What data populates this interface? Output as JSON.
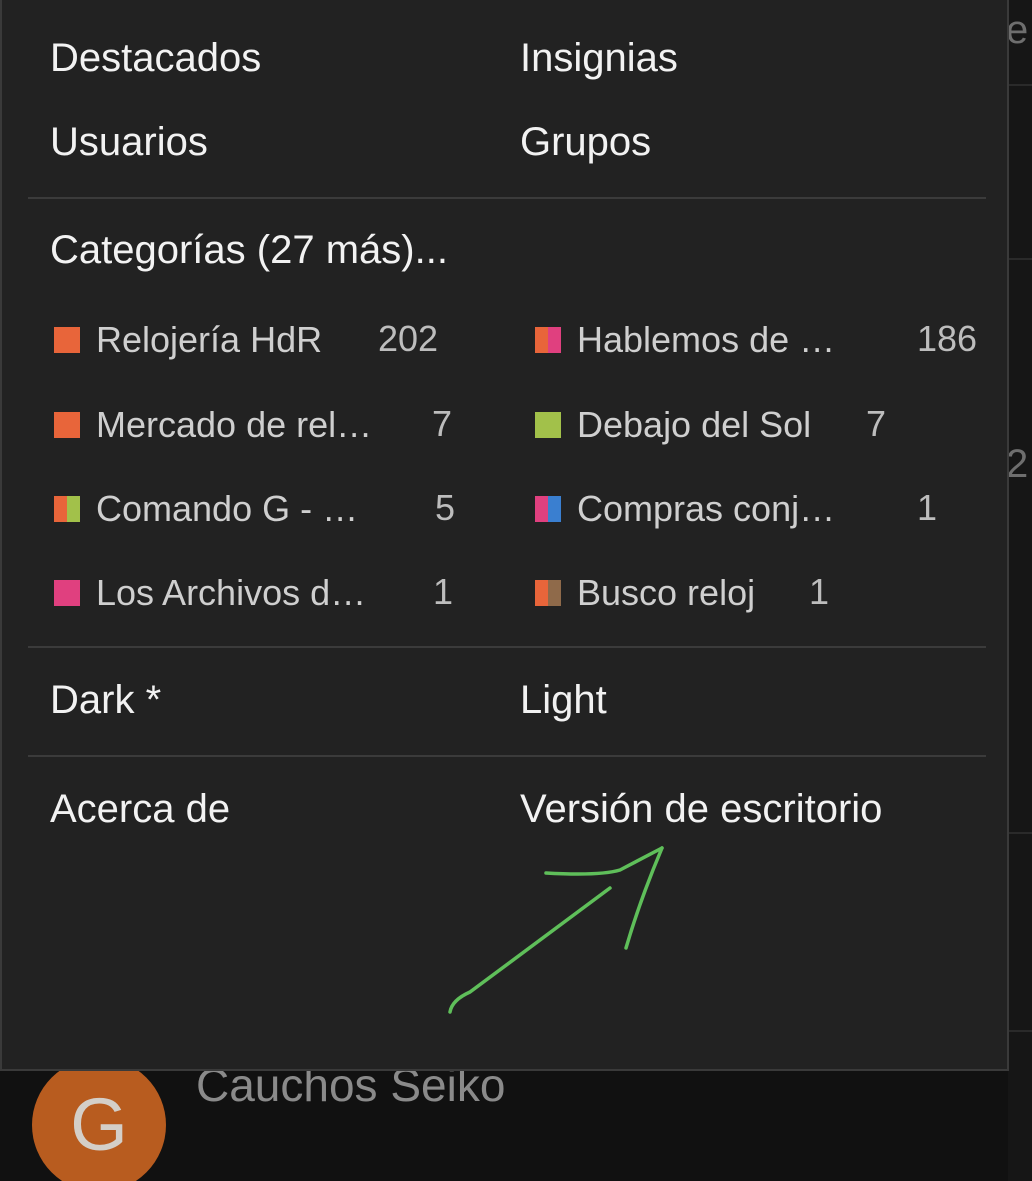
{
  "menu": {
    "links": {
      "featured": "Destacados",
      "badges": "Insignias",
      "users": "Usuarios",
      "groups": "Grupos"
    },
    "categories_header": "Categorías (27 más)...",
    "categories": [
      {
        "name": "Relojería HdR",
        "count": "202",
        "colors": [
          "#e8653a"
        ]
      },
      {
        "name": "Hablemos de …",
        "count": "186",
        "colors": [
          "#e8653a",
          "#e0407f"
        ]
      },
      {
        "name": "Mercado de rel…",
        "count": "7",
        "colors": [
          "#e8653a"
        ]
      },
      {
        "name": "Debajo del Sol",
        "count": "7",
        "colors": [
          "#a2c14a"
        ]
      },
      {
        "name": "Comando G - …",
        "count": "5",
        "colors": [
          "#e8653a",
          "#a2c14a"
        ]
      },
      {
        "name": "Compras conj…",
        "count": "1",
        "colors": [
          "#e0407f",
          "#3a7fd0"
        ]
      },
      {
        "name": "Los Archivos d…",
        "count": "1",
        "colors": [
          "#e0407f"
        ]
      },
      {
        "name": "Busco reloj",
        "count": "1",
        "colors": [
          "#e8653a",
          "#8f6a4a"
        ]
      }
    ],
    "themes": {
      "dark": "Dark *",
      "light": "Light"
    },
    "footer": {
      "about": "Acerca de",
      "desktop": "Versión de escritorio"
    }
  },
  "background": {
    "topic_title": "Cauchos Seiko",
    "avatar_letter": "G",
    "edge_glyph_top": "e",
    "edge_glyph_mid": "2"
  },
  "annotation": {
    "arrow_color": "#5fbf5a"
  }
}
